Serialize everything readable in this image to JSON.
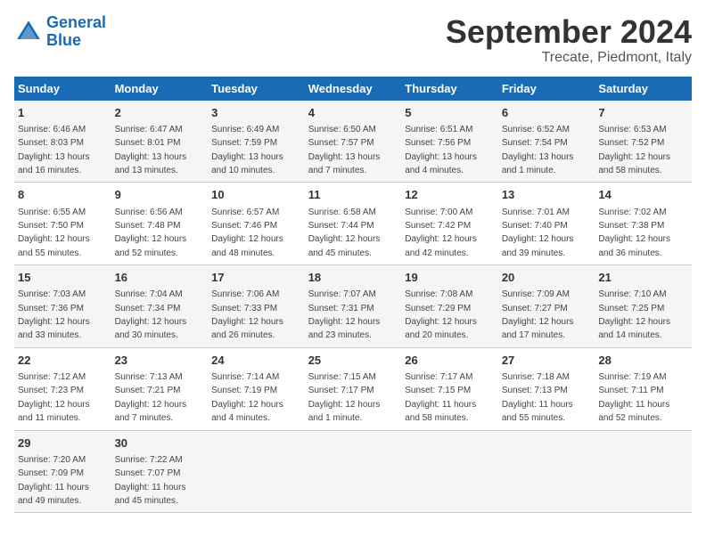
{
  "logo": {
    "line1": "General",
    "line2": "Blue"
  },
  "title": "September 2024",
  "subtitle": "Trecate, Piedmont, Italy",
  "days_of_week": [
    "Sunday",
    "Monday",
    "Tuesday",
    "Wednesday",
    "Thursday",
    "Friday",
    "Saturday"
  ],
  "weeks": [
    [
      {
        "day": "1",
        "info": "Sunrise: 6:46 AM\nSunset: 8:03 PM\nDaylight: 13 hours\nand 16 minutes."
      },
      {
        "day": "2",
        "info": "Sunrise: 6:47 AM\nSunset: 8:01 PM\nDaylight: 13 hours\nand 13 minutes."
      },
      {
        "day": "3",
        "info": "Sunrise: 6:49 AM\nSunset: 7:59 PM\nDaylight: 13 hours\nand 10 minutes."
      },
      {
        "day": "4",
        "info": "Sunrise: 6:50 AM\nSunset: 7:57 PM\nDaylight: 13 hours\nand 7 minutes."
      },
      {
        "day": "5",
        "info": "Sunrise: 6:51 AM\nSunset: 7:56 PM\nDaylight: 13 hours\nand 4 minutes."
      },
      {
        "day": "6",
        "info": "Sunrise: 6:52 AM\nSunset: 7:54 PM\nDaylight: 13 hours\nand 1 minute."
      },
      {
        "day": "7",
        "info": "Sunrise: 6:53 AM\nSunset: 7:52 PM\nDaylight: 12 hours\nand 58 minutes."
      }
    ],
    [
      {
        "day": "8",
        "info": "Sunrise: 6:55 AM\nSunset: 7:50 PM\nDaylight: 12 hours\nand 55 minutes."
      },
      {
        "day": "9",
        "info": "Sunrise: 6:56 AM\nSunset: 7:48 PM\nDaylight: 12 hours\nand 52 minutes."
      },
      {
        "day": "10",
        "info": "Sunrise: 6:57 AM\nSunset: 7:46 PM\nDaylight: 12 hours\nand 48 minutes."
      },
      {
        "day": "11",
        "info": "Sunrise: 6:58 AM\nSunset: 7:44 PM\nDaylight: 12 hours\nand 45 minutes."
      },
      {
        "day": "12",
        "info": "Sunrise: 7:00 AM\nSunset: 7:42 PM\nDaylight: 12 hours\nand 42 minutes."
      },
      {
        "day": "13",
        "info": "Sunrise: 7:01 AM\nSunset: 7:40 PM\nDaylight: 12 hours\nand 39 minutes."
      },
      {
        "day": "14",
        "info": "Sunrise: 7:02 AM\nSunset: 7:38 PM\nDaylight: 12 hours\nand 36 minutes."
      }
    ],
    [
      {
        "day": "15",
        "info": "Sunrise: 7:03 AM\nSunset: 7:36 PM\nDaylight: 12 hours\nand 33 minutes."
      },
      {
        "day": "16",
        "info": "Sunrise: 7:04 AM\nSunset: 7:34 PM\nDaylight: 12 hours\nand 30 minutes."
      },
      {
        "day": "17",
        "info": "Sunrise: 7:06 AM\nSunset: 7:33 PM\nDaylight: 12 hours\nand 26 minutes."
      },
      {
        "day": "18",
        "info": "Sunrise: 7:07 AM\nSunset: 7:31 PM\nDaylight: 12 hours\nand 23 minutes."
      },
      {
        "day": "19",
        "info": "Sunrise: 7:08 AM\nSunset: 7:29 PM\nDaylight: 12 hours\nand 20 minutes."
      },
      {
        "day": "20",
        "info": "Sunrise: 7:09 AM\nSunset: 7:27 PM\nDaylight: 12 hours\nand 17 minutes."
      },
      {
        "day": "21",
        "info": "Sunrise: 7:10 AM\nSunset: 7:25 PM\nDaylight: 12 hours\nand 14 minutes."
      }
    ],
    [
      {
        "day": "22",
        "info": "Sunrise: 7:12 AM\nSunset: 7:23 PM\nDaylight: 12 hours\nand 11 minutes."
      },
      {
        "day": "23",
        "info": "Sunrise: 7:13 AM\nSunset: 7:21 PM\nDaylight: 12 hours\nand 7 minutes."
      },
      {
        "day": "24",
        "info": "Sunrise: 7:14 AM\nSunset: 7:19 PM\nDaylight: 12 hours\nand 4 minutes."
      },
      {
        "day": "25",
        "info": "Sunrise: 7:15 AM\nSunset: 7:17 PM\nDaylight: 12 hours\nand 1 minute."
      },
      {
        "day": "26",
        "info": "Sunrise: 7:17 AM\nSunset: 7:15 PM\nDaylight: 11 hours\nand 58 minutes."
      },
      {
        "day": "27",
        "info": "Sunrise: 7:18 AM\nSunset: 7:13 PM\nDaylight: 11 hours\nand 55 minutes."
      },
      {
        "day": "28",
        "info": "Sunrise: 7:19 AM\nSunset: 7:11 PM\nDaylight: 11 hours\nand 52 minutes."
      }
    ],
    [
      {
        "day": "29",
        "info": "Sunrise: 7:20 AM\nSunset: 7:09 PM\nDaylight: 11 hours\nand 49 minutes."
      },
      {
        "day": "30",
        "info": "Sunrise: 7:22 AM\nSunset: 7:07 PM\nDaylight: 11 hours\nand 45 minutes."
      },
      {
        "day": "",
        "info": ""
      },
      {
        "day": "",
        "info": ""
      },
      {
        "day": "",
        "info": ""
      },
      {
        "day": "",
        "info": ""
      },
      {
        "day": "",
        "info": ""
      }
    ]
  ]
}
